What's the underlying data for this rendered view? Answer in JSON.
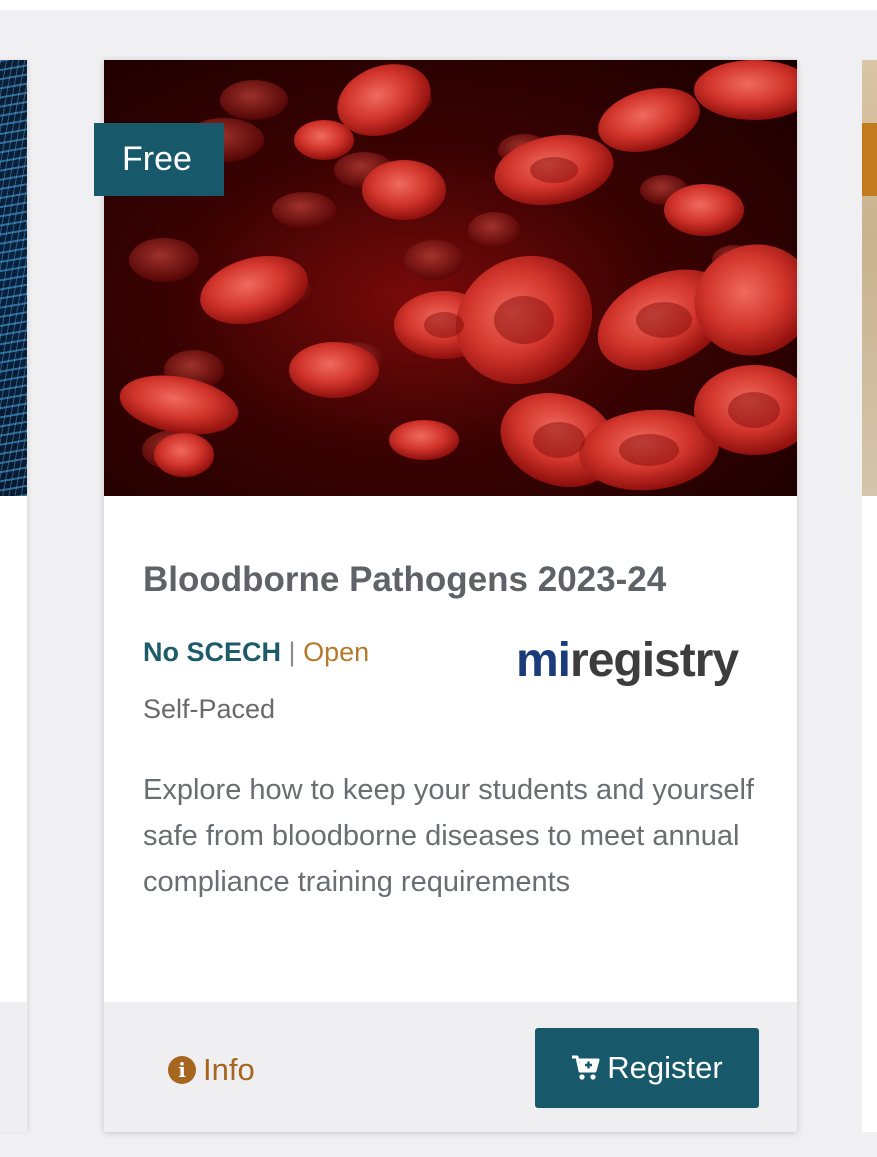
{
  "card": {
    "badge": "Free",
    "image_alt": "Red blood cells",
    "title": "Bloodborne Pathogens 2023-24",
    "credit": "No SCECH",
    "separator": "|",
    "status": "Open",
    "pace": "Self-Paced",
    "provider_logo_text": "miregistry",
    "description": "Explore how to keep your students and yourself safe from bloodborne diseases to meet annual compliance training requirements",
    "info_label": "Info",
    "register_label": "Register"
  },
  "colors": {
    "brand_teal": "#17596b",
    "accent_orange": "#a6661f",
    "logo_navy": "#1a3c7a",
    "logo_gray": "#3d3d3d"
  },
  "icons": [
    "info-circle-icon",
    "cart-plus-icon"
  ]
}
